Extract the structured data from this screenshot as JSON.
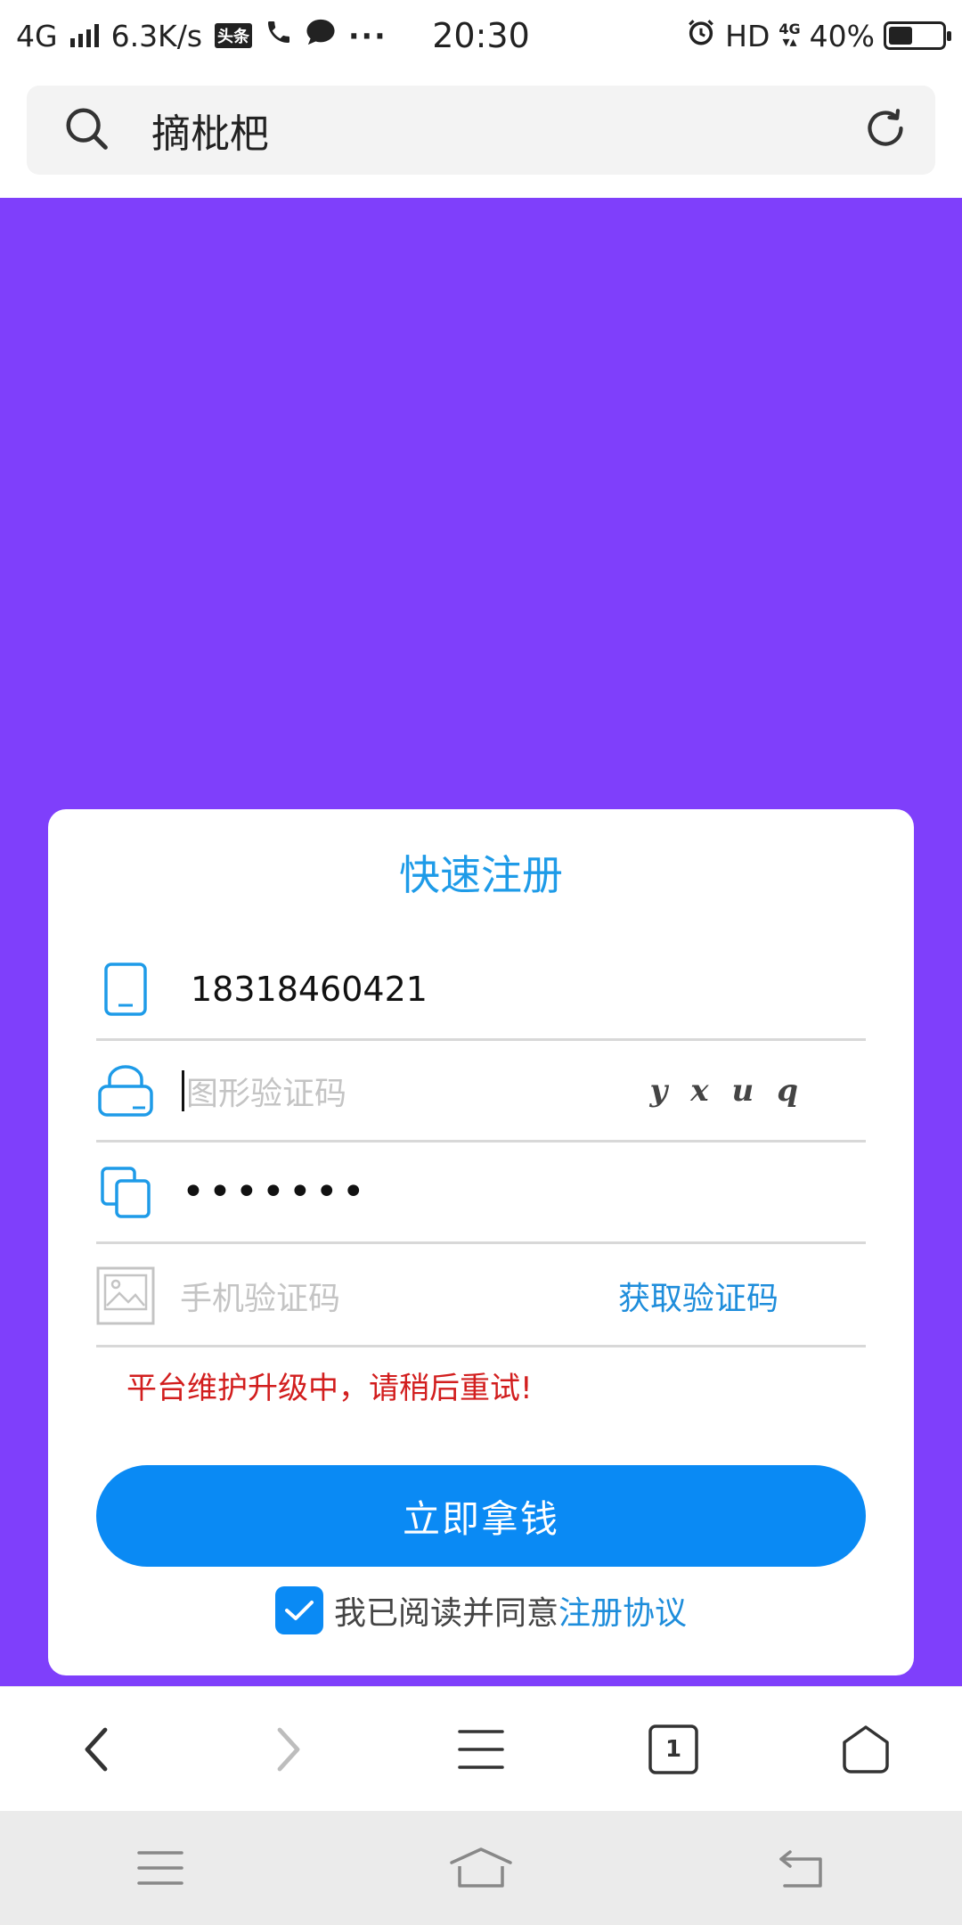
{
  "status_bar": {
    "network": "4G",
    "speed": "6.3K/s",
    "toutiao_badge": "头条",
    "time": "20:30",
    "hd": "HD",
    "hd_network": "4G",
    "battery_text": "40%",
    "battery_level": 0.4
  },
  "address_bar": {
    "text": "摘枇杷",
    "icons": {
      "left": "search-icon",
      "right": "reload-icon"
    }
  },
  "banner": {
    "color": "#7f3ffb"
  },
  "register": {
    "title": "快速注册",
    "phone_value": "18318460421",
    "captcha_placeholder": "图形验证码",
    "captcha_text": "yxuq",
    "password_value": "•••••••",
    "sms_placeholder": "手机验证码",
    "get_code_label": "获取验证码",
    "error_message": "平台维护升级中，请稍后重试!",
    "submit_label": "立即拿钱",
    "agree_prefix": "我已阅读并同意",
    "agree_link": "注册协议",
    "agreed": true,
    "colors": {
      "accent": "#0a8af4",
      "title": "#1e9be8",
      "error": "#d21e1e"
    }
  },
  "browser_toolbar": {
    "tabs_count": "1",
    "icons": [
      "back-icon",
      "forward-icon",
      "menu-icon",
      "tabs-icon",
      "home-icon"
    ]
  },
  "nav_bar": {
    "icons": [
      "recent-apps-icon",
      "home-icon",
      "back-icon"
    ]
  }
}
